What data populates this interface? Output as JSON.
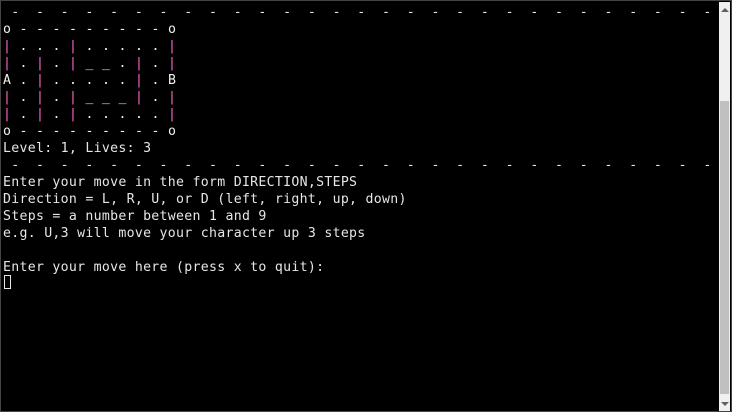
{
  "terminal": {
    "lines": [
      " -  -  -  -  -  -  -  -  -  -  -  -  -  -  -  -  -  -  -  -  -  -  -  -  -  -  -  -  - ",
      "o - - - - - - - - - o",
      "| . . . | . . . . . |",
      "| . | . | _ _ . | . |",
      "A . | . . . . . | . B",
      "| . | . | _ _ _ | . |",
      "| . | . | . . . . . |",
      "o - - - - - - - - - o",
      "Level: 1, Lives: 3",
      " -  -  -  -  -  -  -  -  -  -  -  -  -  -  -  -  -  -  -  -  -  -  -  -  -  -  -  -  - ",
      "Enter your move in the form DIRECTION,STEPS",
      "Direction = L, R, U, or D (left, right, up, down)",
      "Steps = a number between 1 and 9",
      "e.g. U,3 will move your character up 3 steps",
      "",
      "Enter your move here (press x to quit):"
    ]
  },
  "colors": {
    "background": "#000000",
    "text": "#e6e6e6",
    "maze_wall": "#ff66cc"
  },
  "icons": {
    "scroll_up": "scroll-up-arrow-icon",
    "scroll_down": "scroll-down-arrow-icon"
  }
}
